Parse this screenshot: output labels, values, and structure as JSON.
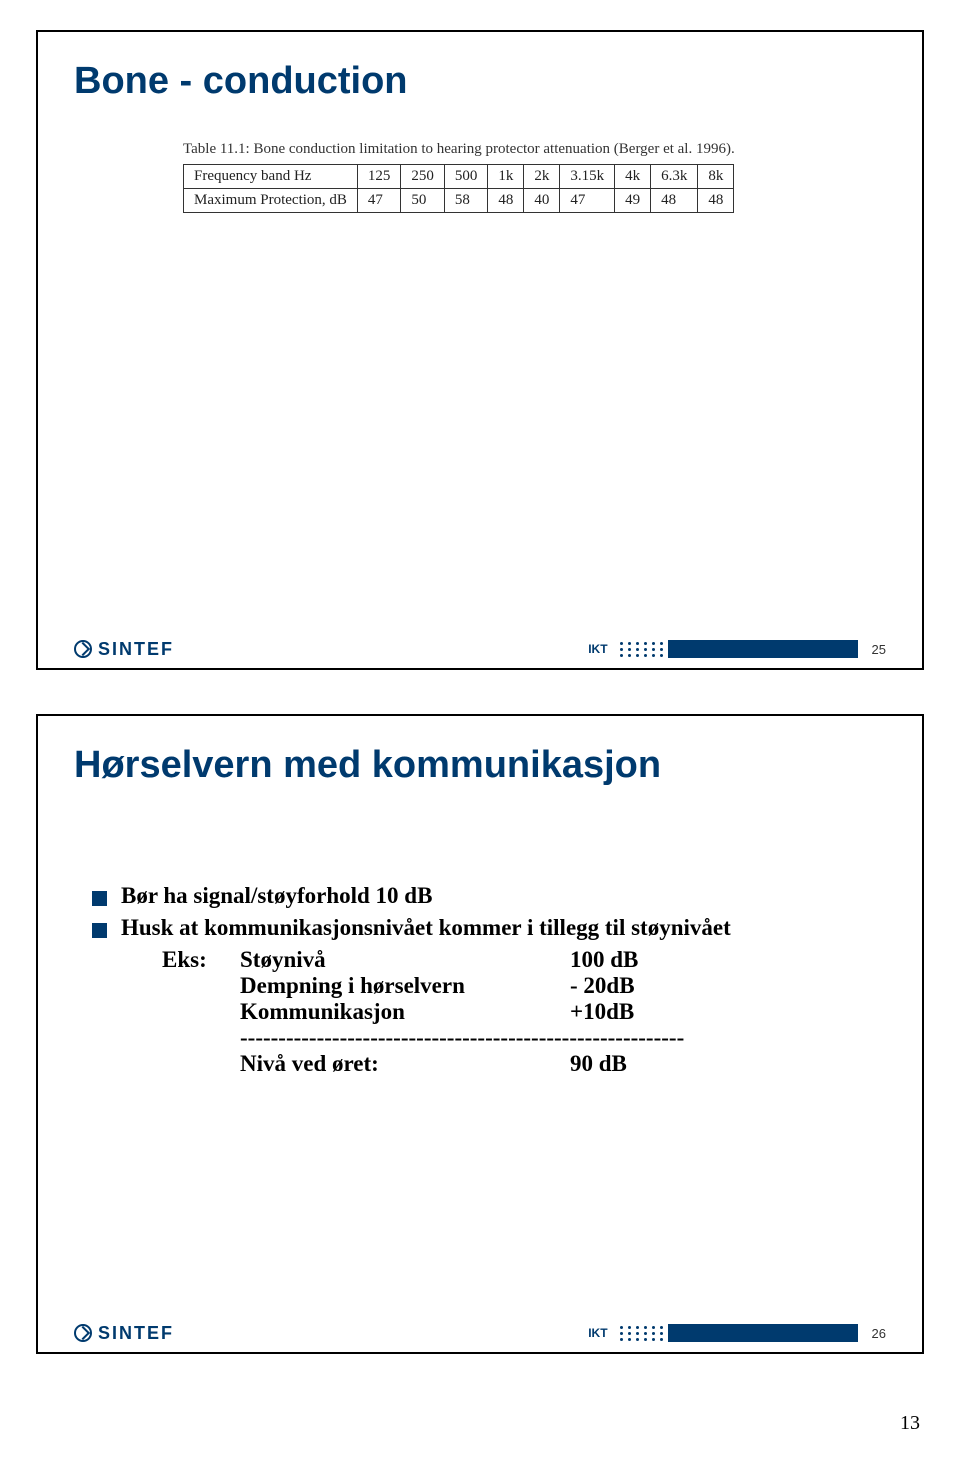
{
  "slide1": {
    "title": "Bone - conduction",
    "table": {
      "caption": "Table 11.1: Bone conduction limitation to hearing protector attenuation (Berger et al. 1996).",
      "row_labels": [
        "Frequency band Hz",
        "Maximum Protection, dB"
      ],
      "cols": [
        "125",
        "250",
        "500",
        "1k",
        "2k",
        "3.15k",
        "4k",
        "6.3k",
        "8k"
      ],
      "values": [
        "47",
        "50",
        "58",
        "48",
        "40",
        "47",
        "49",
        "48",
        "48"
      ]
    },
    "footer": {
      "brand": "SINTEF",
      "ikt": "IKT",
      "slide_num": "25"
    }
  },
  "slide2": {
    "title": "Hørselvern med kommunikasjon",
    "b1": "Bør ha signal/støyforhold 10 dB",
    "b2": "Husk at kommunikasjonsnivået kommer i tillegg til støynivået",
    "eks_label": "Eks:",
    "rows": [
      {
        "name": "Støynivå",
        "val": "100 dB"
      },
      {
        "name": "Dempning i hørselvern",
        "val": "- 20dB"
      },
      {
        "name": "Kommunikasjon",
        "val": "+10dB"
      }
    ],
    "divider": "----------------------------------------------------------",
    "result": {
      "name": "Nivå ved øret:",
      "val": "90 dB"
    },
    "footer": {
      "brand": "SINTEF",
      "ikt": "IKT",
      "slide_num": "26"
    }
  },
  "page_number": "13"
}
